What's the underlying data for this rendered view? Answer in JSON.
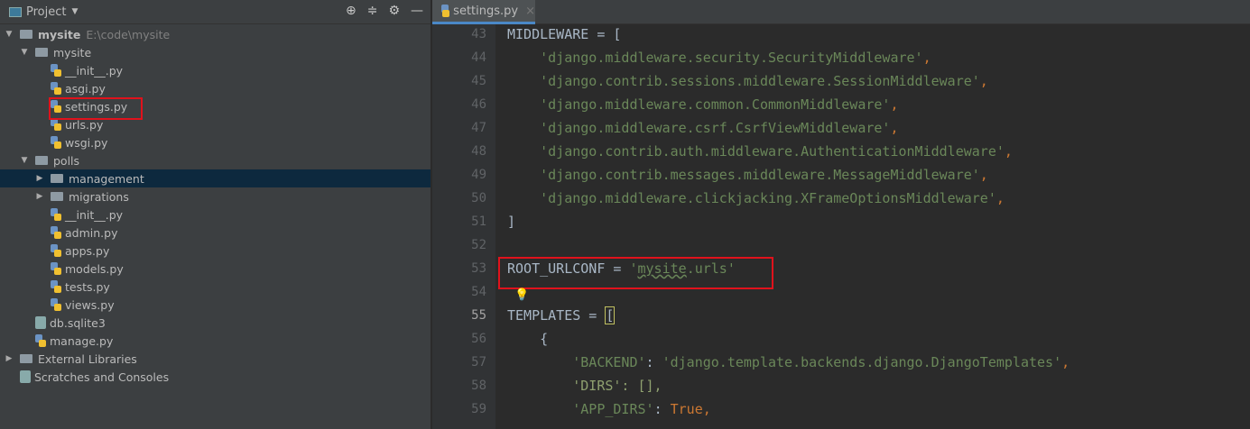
{
  "sidebar": {
    "title": "Project",
    "root": {
      "name": "mysite",
      "path": "E:\\code\\mysite"
    },
    "items": [
      {
        "label": "mysite",
        "type": "folder",
        "depth": 1,
        "open": true
      },
      {
        "label": "__init__.py",
        "type": "py",
        "depth": 2
      },
      {
        "label": "asgi.py",
        "type": "py",
        "depth": 2
      },
      {
        "label": "settings.py",
        "type": "py",
        "depth": 2,
        "highlighted": true
      },
      {
        "label": "urls.py",
        "type": "py",
        "depth": 2
      },
      {
        "label": "wsgi.py",
        "type": "py",
        "depth": 2
      },
      {
        "label": "polls",
        "type": "folder",
        "depth": 1,
        "open": true
      },
      {
        "label": "management",
        "type": "folder",
        "depth": 2,
        "open": false,
        "selected": true
      },
      {
        "label": "migrations",
        "type": "folder",
        "depth": 2,
        "open": false
      },
      {
        "label": "__init__.py",
        "type": "py",
        "depth": 2
      },
      {
        "label": "admin.py",
        "type": "py",
        "depth": 2
      },
      {
        "label": "apps.py",
        "type": "py",
        "depth": 2
      },
      {
        "label": "models.py",
        "type": "py",
        "depth": 2
      },
      {
        "label": "tests.py",
        "type": "py",
        "depth": 2
      },
      {
        "label": "views.py",
        "type": "py",
        "depth": 2
      },
      {
        "label": "db.sqlite3",
        "type": "db",
        "depth": 1
      },
      {
        "label": "manage.py",
        "type": "py",
        "depth": 1
      },
      {
        "label": "External Libraries",
        "type": "lib",
        "depth": 0,
        "open": false
      },
      {
        "label": "Scratches and Consoles",
        "type": "scratch",
        "depth": 0
      }
    ]
  },
  "editor": {
    "tab": "settings.py",
    "current_line": 55,
    "lines": [
      {
        "n": 43,
        "text": "MIDDLEWARE = ["
      },
      {
        "n": 44,
        "text": "    'django.middleware.security.SecurityMiddleware',"
      },
      {
        "n": 45,
        "text": "    'django.contrib.sessions.middleware.SessionMiddleware',"
      },
      {
        "n": 46,
        "text": "    'django.middleware.common.CommonMiddleware',"
      },
      {
        "n": 47,
        "text": "    'django.middleware.csrf.CsrfViewMiddleware',"
      },
      {
        "n": 48,
        "text": "    'django.contrib.auth.middleware.AuthenticationMiddleware',"
      },
      {
        "n": 49,
        "text": "    'django.contrib.messages.middleware.MessageMiddleware',"
      },
      {
        "n": 50,
        "text": "    'django.middleware.clickjacking.XFrameOptionsMiddleware',"
      },
      {
        "n": 51,
        "text": "]"
      },
      {
        "n": 52,
        "text": ""
      },
      {
        "n": 53,
        "text": "ROOT_URLCONF = 'mysite.urls'"
      },
      {
        "n": 54,
        "text": ""
      },
      {
        "n": 55,
        "text": "TEMPLATES = ["
      },
      {
        "n": 56,
        "text": "    {"
      },
      {
        "n": 57,
        "text": "        'BACKEND': 'django.template.backends.django.DjangoTemplates',"
      },
      {
        "n": 58,
        "text": "        'DIRS': [],"
      },
      {
        "n": 59,
        "text": "        'APP_DIRS': True,"
      }
    ]
  }
}
